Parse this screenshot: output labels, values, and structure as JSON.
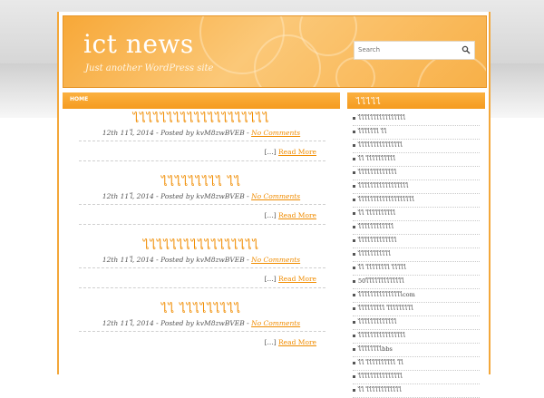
{
  "site": {
    "title": "ict news",
    "tagline": "Just another WordPress site"
  },
  "search": {
    "placeholder": "Search"
  },
  "nav": {
    "items": [
      {
        "label": "HOME"
      }
    ]
  },
  "sidebar": {
    "heading": "ไไไไไ",
    "items": [
      {
        "label": "ไไไไไไไไไไไไไไไไ"
      },
      {
        "label": "ไไไไไไไ ไไ"
      },
      {
        "label": "ไไไไไไไไไไไไไไไ"
      },
      {
        "label": "ไไ ไไไไไไไไไไ"
      },
      {
        "label": "ไไไไไไไไไไไไไ"
      },
      {
        "label": "ไไไไไไไไไไไไไไไไไ"
      },
      {
        "label": "ไไไไไไไไไไไไไไไไไไไ"
      },
      {
        "label": "ไไ ไไไไไไไไไไ"
      },
      {
        "label": "ไไไไไไไไไไไไ"
      },
      {
        "label": "ไไไไไไไไไไไไไ"
      },
      {
        "label": "ไไไไไไไไไไไ"
      },
      {
        "label": "ไไ ไไไไไไไไ ไไไไไ"
      },
      {
        "label": "50ไไไไไไไไไไไไไ"
      },
      {
        "label": "ไไไไไไไไไไไไไไไcom"
      },
      {
        "label": "ไไไไไไไไไ ไไไไไไไไไ"
      },
      {
        "label": "ไไไไไไไไไไไไไ"
      },
      {
        "label": "ไไไไไไไไไไไไไไไไ"
      },
      {
        "label": "ไไไไไไไไbbs"
      },
      {
        "label": "ไไ ไไไไไไไไไไ ไไ"
      },
      {
        "label": "ไไไไไไไไไไไไไไไ"
      },
      {
        "label": "ไไ ไไไไไไไไไไไไ"
      }
    ]
  },
  "posts": [
    {
      "title": "ไไไไไไไไไไไไไไไไไไไไ",
      "meta_prefix": "12th 11ไ, 2014 - Posted by kvM8zwBVEB -",
      "comments": "No Comments",
      "excerpt": "[...]",
      "read_more": "Read More"
    },
    {
      "title": "ไไไไไไไไไ ไไ",
      "meta_prefix": "12th 11ไ, 2014 - Posted by kvM8zwBVEB -",
      "comments": "No Comments",
      "excerpt": "[...]",
      "read_more": "Read More"
    },
    {
      "title": "ไไไไไไไไไไไไไไไไไ",
      "meta_prefix": "12th 11ไ, 2014 - Posted by kvM8zwBVEB -",
      "comments": "No Comments",
      "excerpt": "[...]",
      "read_more": "Read More"
    },
    {
      "title": "ไไ ไไไไไไไไไ",
      "meta_prefix": "12th 11ไ, 2014 - Posted by kvM8zwBVEB -",
      "comments": "No Comments",
      "excerpt": "[...]",
      "read_more": "Read More"
    }
  ],
  "colors": {
    "accent": "#f08c00",
    "header_orange": "#f7a838",
    "nav_orange": "#f59b1f"
  }
}
